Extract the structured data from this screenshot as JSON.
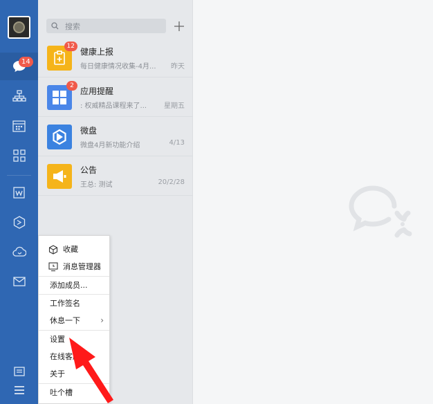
{
  "rail": {
    "chat_badge": "14",
    "items": [
      "chat-icon",
      "contacts-org-icon",
      "calendar-icon",
      "apps-grid-icon",
      "doc-w-icon",
      "weidrive-icon",
      "cloud-meeting-icon",
      "mail-icon",
      "minimize-icon",
      "hamburger-menu-icon"
    ]
  },
  "search": {
    "placeholder": "搜索"
  },
  "conversations": [
    {
      "name": "健康上报",
      "preview": "每日健康情况收集-4月...",
      "time": "昨天",
      "badge": "12",
      "color": "#f5b41a",
      "icon": "health-report-icon"
    },
    {
      "name": "应用提醒",
      "preview": ": 权威精品课程来了...",
      "time": "星期五",
      "badge": "2",
      "color": "#4a86e8",
      "icon": "app-reminder-icon"
    },
    {
      "name": "微盘",
      "preview": "微盘4月新功能介绍",
      "time": "4/13",
      "badge": "",
      "color": "#3b82e0",
      "icon": "weidrive-app-icon"
    },
    {
      "name": "公告",
      "preview": "王总: 测试",
      "time": "20/2/28",
      "badge": "",
      "color": "#f5b41a",
      "icon": "announcement-icon"
    }
  ],
  "menu": {
    "favorites": "收藏",
    "message_manager": "消息管理器",
    "add_member": "添加成员...",
    "work_signature": "工作签名",
    "take_break": "休息一下",
    "settings": "设置",
    "online_service": "在线客服",
    "about": "关于",
    "feedback": "吐个槽"
  }
}
